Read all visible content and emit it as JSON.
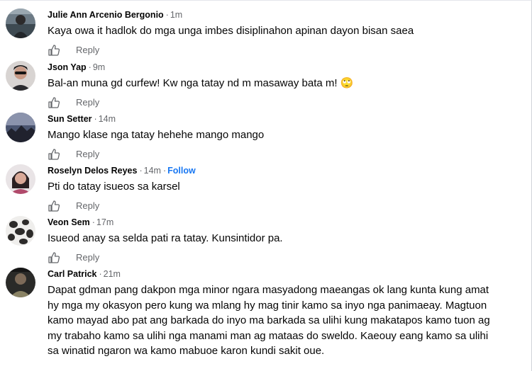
{
  "comments": [
    {
      "author": "Julie Ann Arcenio Bergonio",
      "time": "1m",
      "text": "Kaya owa it hadlok do mga unga imbes disiplinahon apinan dayon bisan saea",
      "reply_label": "Reply",
      "avatar_icon": "profile-photo-icon"
    },
    {
      "author": "Json Yap",
      "time": "9m",
      "text": "Bal-an muna gd curfew! Kw nga tatay nd m masaway bata m!",
      "emoji": "🙄",
      "reply_label": "Reply",
      "avatar_icon": "profile-photo-icon"
    },
    {
      "author": "Sun Setter",
      "time": "14m",
      "text": "Mango klase nga tatay hehehe mango mango",
      "reply_label": "Reply",
      "avatar_icon": "profile-photo-icon"
    },
    {
      "author": "Roselyn Delos Reyes",
      "time": "14m",
      "follow_label": "Follow",
      "text": "Pti do tatay isueos sa karsel",
      "reply_label": "Reply",
      "avatar_icon": "profile-photo-icon"
    },
    {
      "author": "Veon Sem",
      "time": "17m",
      "text": "Isueod anay sa selda pati ra tatay. Kunsintidor pa.",
      "reply_label": "Reply",
      "avatar_icon": "profile-photo-icon"
    },
    {
      "author": "Carl Patrick",
      "time": "21m",
      "text": "Dapat gdman pang dakpon mga minor ngara masyadong maeangas ok lang kunta kung amat hy mga my okasyon pero kung wa mlang hy mag tinir kamo sa inyo nga panimaeay. Magtuon kamo mayad abo pat ang barkada do inyo ma barkada sa ulihi kung makatapos kamo tuon ag my trabaho kamo sa ulihi nga manami man ag mataas do sweldo. Kaeouy eang kamo sa ulihi sa winatid ngaron wa kamo mabuoe karon kundi sakit oue.",
      "reply_label": "Reply",
      "avatar_icon": "profile-photo-icon"
    }
  ],
  "separator": "·",
  "like_icon": "thumbs-up-icon",
  "colors": {
    "name": "#050505",
    "meta": "#65676b",
    "follow": "#1877f2",
    "text": "#050505"
  }
}
